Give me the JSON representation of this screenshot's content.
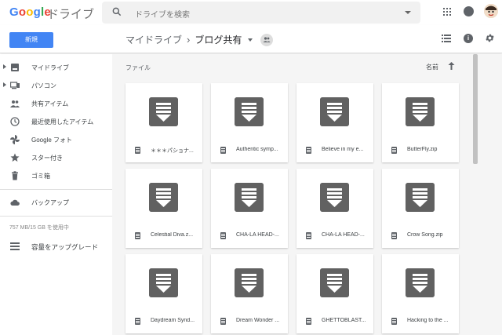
{
  "header": {
    "logo_google": "Google",
    "logo_product": "ドライブ",
    "search_placeholder": "ドライブを検索"
  },
  "toolbar": {
    "new_label": "新規",
    "breadcrumb": {
      "parent": "マイドライブ",
      "current": "ブログ共有"
    },
    "sort_label": "名前"
  },
  "sidebar": {
    "items": [
      {
        "label": "マイドライブ",
        "icon": "drive-icon"
      },
      {
        "label": "パソコン",
        "icon": "computer-icon"
      },
      {
        "label": "共有アイテム",
        "icon": "shared-icon"
      },
      {
        "label": "最近使用したアイテム",
        "icon": "clock-icon"
      },
      {
        "label": "Google フォト",
        "icon": "photos-icon"
      },
      {
        "label": "スター付き",
        "icon": "star-icon"
      },
      {
        "label": "ゴミ箱",
        "icon": "trash-icon"
      },
      {
        "label": "バックアップ",
        "icon": "cloud-icon"
      }
    ],
    "storage_text": "757 MB/15 GB を使用中",
    "upgrade_label": "容量をアップグレード"
  },
  "main": {
    "section_label": "ファイル",
    "files": [
      {
        "name": "＊＊＊パショナ..."
      },
      {
        "name": "Authentic symp..."
      },
      {
        "name": "Believe in my e..."
      },
      {
        "name": "ButterFly.zip"
      },
      {
        "name": "Celestial Diva.z..."
      },
      {
        "name": "CHA-LA HEAD-..."
      },
      {
        "name": "CHA-LA HEAD-..."
      },
      {
        "name": "Crow Song.zip"
      },
      {
        "name": "Daydream Synd..."
      },
      {
        "name": "Dream Wonder ..."
      },
      {
        "name": "GHETTOBLAST..."
      },
      {
        "name": "Hacking to the ..."
      }
    ]
  },
  "colors": {
    "accent": "#4285f4",
    "icon_gray": "#616161"
  }
}
